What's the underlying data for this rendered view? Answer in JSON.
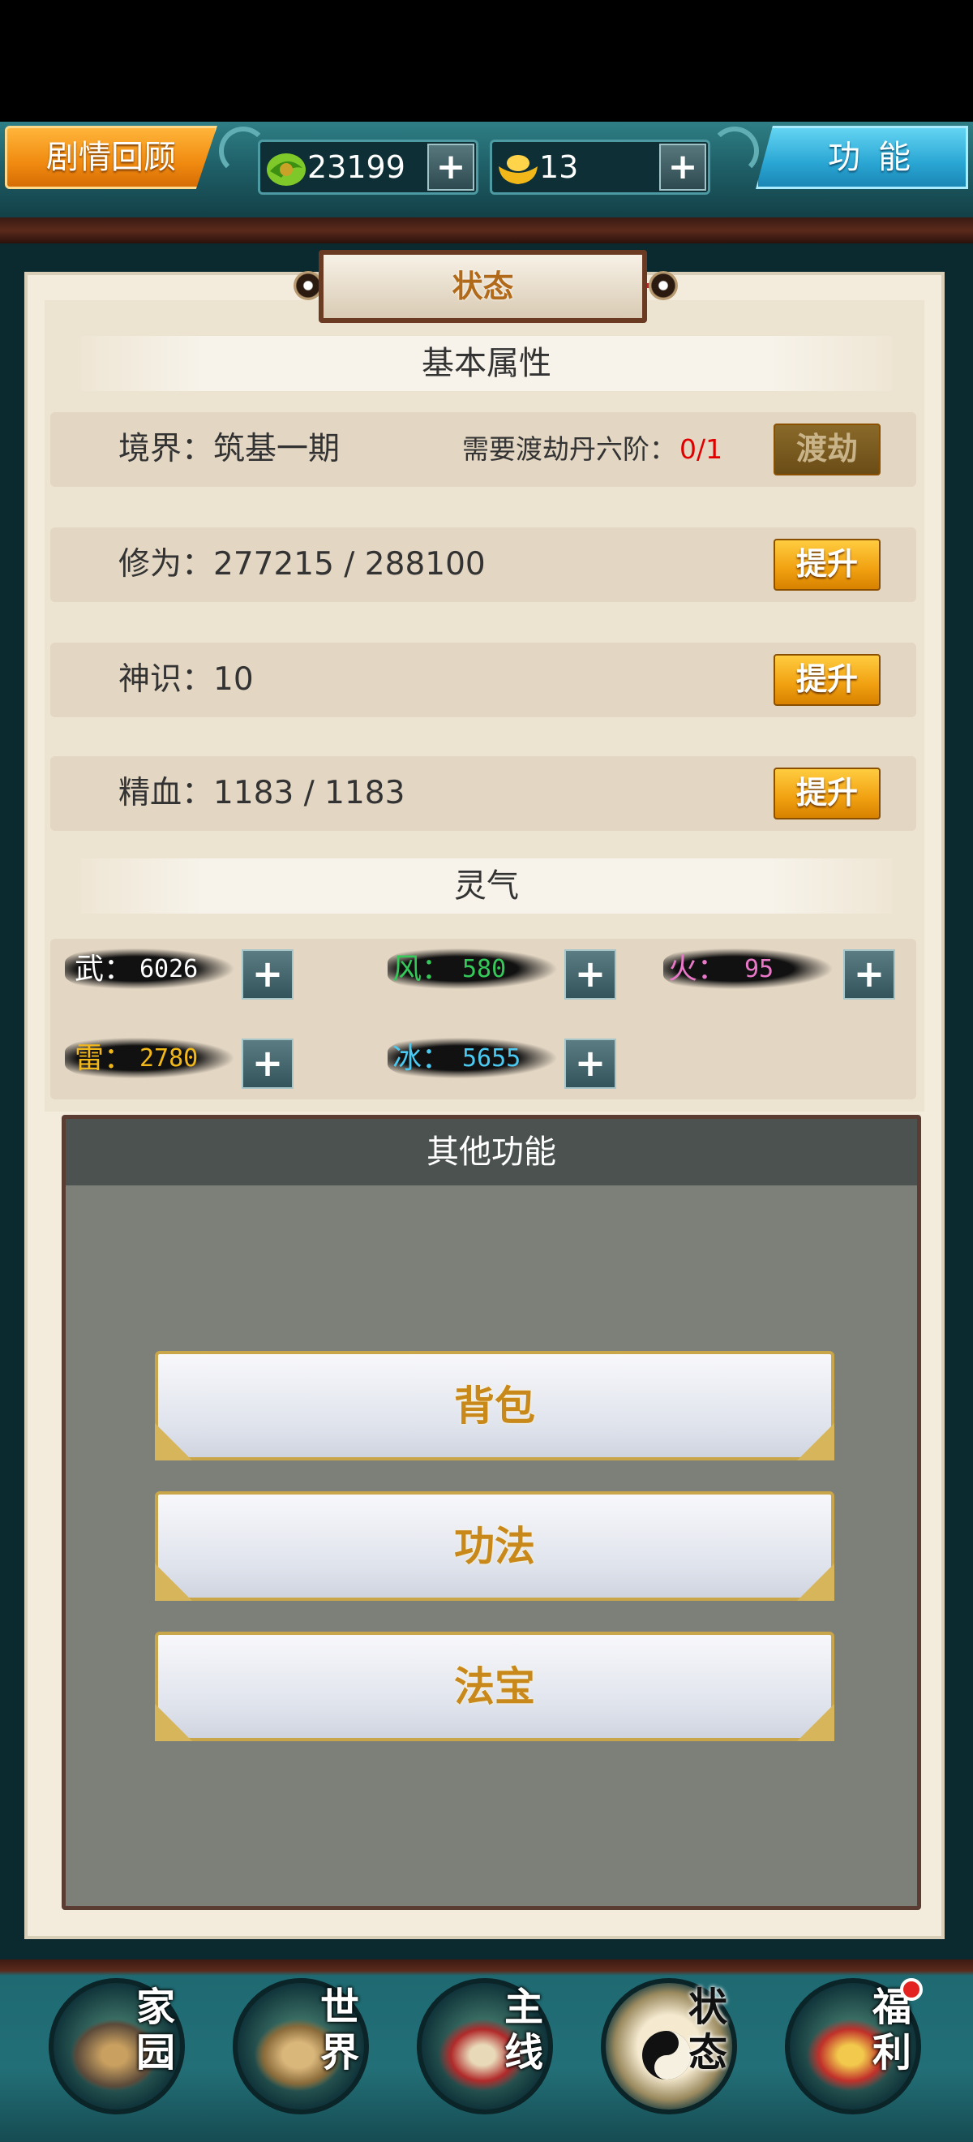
{
  "topbar": {
    "review_label": "剧情回顾",
    "function_label": "功能",
    "jade_amount": "23199",
    "gold_amount": "13",
    "plus": "+"
  },
  "panel": {
    "title": "状态",
    "basic_header": "基本属性",
    "spirit_header": "灵气"
  },
  "attributes": [
    {
      "label": "境界：筑基一期",
      "requirement": "需要渡劫丹六阶：",
      "requirement_value": "0/1",
      "button": "渡劫"
    },
    {
      "label": "修为：277215 / 288100",
      "button": "提升"
    },
    {
      "label": "神识：10",
      "button": "提升"
    },
    {
      "label": "精血：1183 / 1183",
      "button": "提升"
    }
  ],
  "elements": [
    {
      "name": "武：",
      "value": "6026",
      "color": "#ffffff"
    },
    {
      "name": "风：",
      "value": "580",
      "color": "#35c95a"
    },
    {
      "name": "火：",
      "value": "95",
      "color": "#e978c8"
    },
    {
      "name": "雷：",
      "value": "2780",
      "color": "#f2b81a"
    },
    {
      "name": "冰：",
      "value": "5655",
      "color": "#4cc9f0"
    }
  ],
  "other": {
    "header": "其他功能",
    "buttons": [
      "背包",
      "功法",
      "法宝"
    ]
  },
  "nav": [
    {
      "label": "家园",
      "icon": "home-icon"
    },
    {
      "label": "世界",
      "icon": "world-icon"
    },
    {
      "label": "主线",
      "icon": "mainline-icon"
    },
    {
      "label": "状态",
      "icon": "bagua-icon"
    },
    {
      "label": "福利",
      "icon": "gift-icon"
    }
  ]
}
